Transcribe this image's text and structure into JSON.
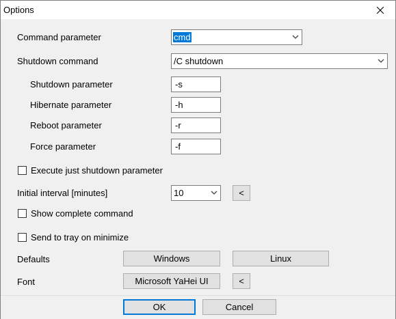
{
  "window": {
    "title": "Options"
  },
  "labels": {
    "command_parameter": "Command parameter",
    "shutdown_command": "Shutdown command",
    "shutdown_parameter": "Shutdown parameter",
    "hibernate_parameter": "Hibernate parameter",
    "reboot_parameter": "Reboot parameter",
    "force_parameter": "Force parameter",
    "initial_interval": "Initial interval [minutes]",
    "defaults": "Defaults",
    "font": "Font"
  },
  "values": {
    "command_parameter": "cmd",
    "shutdown_command": "/C shutdown",
    "shutdown_parameter": "-s",
    "hibernate_parameter": "-h",
    "reboot_parameter": "-r",
    "force_parameter": "-f",
    "initial_interval": "10"
  },
  "checkboxes": {
    "execute_shutdown_only": {
      "label": "Execute just shutdown parameter",
      "checked": false
    },
    "show_complete_command": {
      "label": "Show complete command",
      "checked": false
    },
    "send_to_tray": {
      "label": "Send to tray on minimize",
      "checked": false
    }
  },
  "buttons": {
    "interval_less": "<",
    "windows": "Windows",
    "linux": "Linux",
    "font_name": "Microsoft YaHei UI",
    "font_less": "<",
    "ok": "OK",
    "cancel": "Cancel"
  },
  "colors": {
    "accent": "#0078d7",
    "window_bg": "#f0f0f0",
    "button_bg": "#e1e1e1"
  },
  "icons": {
    "close": "close-icon",
    "dropdown": "chevron-down-icon"
  }
}
